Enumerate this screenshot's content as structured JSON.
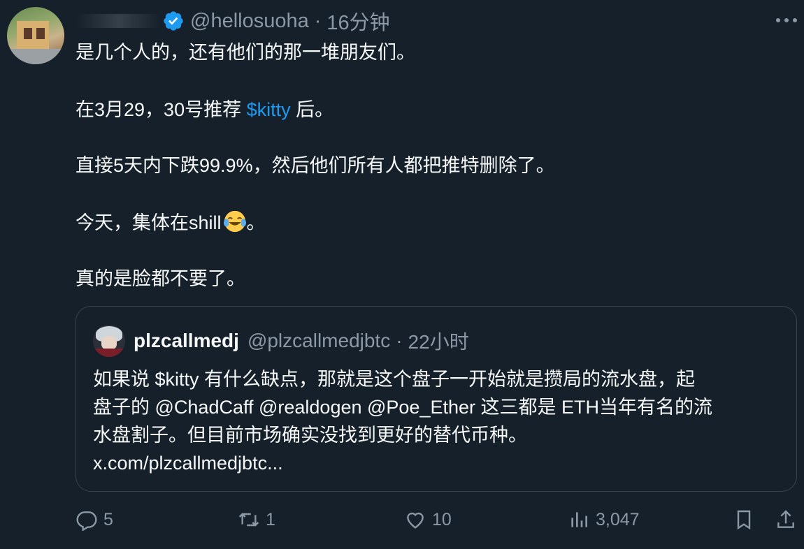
{
  "post": {
    "handle": "@hellosuoha",
    "separator": "·",
    "time": "16分钟",
    "line1_text": "是几个人的，还有他们的那一堆朋友们。",
    "line2_before": "在3月29，30号推荐 ",
    "line2_cashtag": "$kitty",
    "line2_after": " 后。",
    "line3": "直接5天内下跌99.9%，然后他们所有人都把推特删除了。",
    "line4_text": "今天，集体在shill",
    "line4_after": "。",
    "line5": "真的是脸都不要了。"
  },
  "quote": {
    "name": "plzcallmedj",
    "handle": "@plzcallmedjbtc",
    "separator": "·",
    "time": "22小时",
    "line1": "如果说 $kitty 有什么缺点，那就是这个盘子一开始就是攒局的流水盘，起",
    "line2": "盘子的 @ChadCaff @realdogen @Poe_Ether 这三都是 ETH当年有名的流",
    "line3": "水盘割子。但目前市场确实没找到更好的替代币种。",
    "line4": "x.com/plzcallmedjbtc..."
  },
  "actions": {
    "replies": "5",
    "reposts": "1",
    "likes": "10",
    "views": "3,047"
  },
  "colors": {
    "background": "#15202b",
    "text": "#f7f9f9",
    "muted": "#8b98a5",
    "accent": "#1d9bf0",
    "border": "#38444d"
  }
}
